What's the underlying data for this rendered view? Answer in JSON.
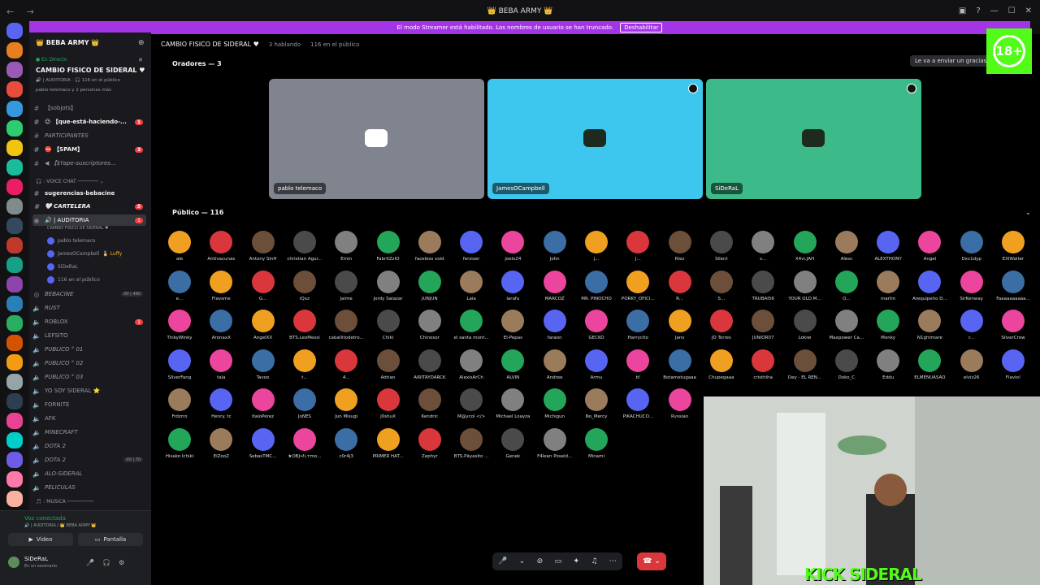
{
  "window": {
    "title": "👑 BEBA ARMY 👑",
    "nav": "← →"
  },
  "banner": {
    "text": "El modo Streamer está habilitado. Los nombres de usuario se han truncado.",
    "button": "Deshabilitar"
  },
  "guild": {
    "name": "👑 BEBA ARMY 👑"
  },
  "event": {
    "live": "● En Directo",
    "title": "CAMBIO FISICO DE SIDERAL ♥",
    "meta": "🔊 | AUDITORIA · 🎧 116 en el público",
    "sub": "pablo telemaco y 2 personas más"
  },
  "channels": [
    {
      "label": "【sobjots】",
      "icon": "#",
      "style": ""
    },
    {
      "label": "😕 【que-está-haciendo-...",
      "icon": "#",
      "style": "bold",
      "badge": "1"
    },
    {
      "label": "PARTICIPANTES",
      "icon": "#",
      "style": "italic"
    },
    {
      "label": "⛔ 【SPAM】",
      "icon": "#",
      "style": "bold",
      "badge": "3"
    },
    {
      "label": "◀ 【$Yape-suscriptores...",
      "icon": "#",
      "style": "italic"
    },
    {
      "label": "🎧 : VOICE CHAT ─────── ⌄",
      "icon": "",
      "style": "cat"
    },
    {
      "label": "sugerencias-bebacine",
      "icon": "#",
      "style": "bold"
    },
    {
      "label": "🤍 CARTELERA",
      "icon": "#",
      "style": "bold italic",
      "badge": "5"
    },
    {
      "label": "🔊 | AUDITORIA",
      "icon": "◉",
      "style": "active",
      "badge": "1"
    }
  ],
  "subheading": "CAMBIO FISICO DE SIDERAL ♥",
  "voice_users": [
    {
      "name": "pablo telemaco",
      "tag": ""
    },
    {
      "name": "JamesOCampbell",
      "tag": "🏅 Luffy"
    },
    {
      "name": "SiDeRaL",
      "tag": ""
    },
    {
      "name": "116 en el público",
      "tag": ""
    }
  ],
  "channels2": [
    {
      "label": "BEBACINE",
      "icon": "◎",
      "style": "italic",
      "cnt": "00 | 490"
    },
    {
      "label": "RUST",
      "icon": "🔈",
      "style": "italic"
    },
    {
      "label": "ROBLOX",
      "icon": "🔈",
      "style": "",
      "badge": "1"
    },
    {
      "label": "LEFSITO",
      "icon": "🔈",
      "style": ""
    },
    {
      "label": "PUBLICO ° 01",
      "icon": "🔈",
      "style": "italic"
    },
    {
      "label": "PUBLICO ° 02",
      "icon": "🔈",
      "style": "italic"
    },
    {
      "label": "PUBLICO ° 03",
      "icon": "🔈",
      "style": "italic"
    },
    {
      "label": "YO SOY SIDERAL ⭐",
      "icon": "🔈",
      "style": ""
    },
    {
      "label": "FORNITE",
      "icon": "🔈",
      "style": ""
    },
    {
      "label": "AFK",
      "icon": "🔈",
      "style": ""
    },
    {
      "label": "MINECRAFT",
      "icon": "🔈",
      "style": "italic"
    },
    {
      "label": "DOTA 2",
      "icon": "🔈",
      "style": "italic"
    },
    {
      "label": "DOTA 2",
      "icon": "🔈",
      "style": "italic",
      "cnt": "00 | 70"
    },
    {
      "label": "ALO-SIDERAL",
      "icon": "🔈",
      "style": "italic"
    },
    {
      "label": "PELICULAS",
      "icon": "🔈",
      "style": "italic"
    },
    {
      "label": "🎵 : MUSICA ─────────",
      "icon": "",
      "style": "cat"
    }
  ],
  "voice_panel": {
    "status": "Voz conectada",
    "sub": "🔊 | AUDITORIA / 👑 BEBA ARMY 👑",
    "video": "Video",
    "screen": "Pantalla"
  },
  "user": {
    "name": "SiDeRaL",
    "status": "En un escenario"
  },
  "stage": {
    "title": "CAMBIO FISICO DE SIDERAL ♥",
    "speaking": "3 hablando",
    "audience": "116 en el público"
  },
  "speakers_heading": "Oradores — 3",
  "speakers": [
    {
      "name": "pablo telemaco",
      "color": "#80848e"
    },
    {
      "name": "JamesOCampbell",
      "color": "#3ec7ee"
    },
    {
      "name": "SiDeRaL",
      "color": "#3dba8a"
    }
  ],
  "public_heading": "Público — 116",
  "toast": "Le va a enviar un gracias p",
  "age_badge": "18+",
  "audience": [
    [
      "ale",
      "Antivacunas",
      "Antony SinH",
      "christian Agui...",
      "Emin",
      "FabritZzIO",
      "faceless void",
      "ferzizer",
      "joelx24",
      "John",
      "j...",
      "J...",
      "Riez",
      "Silent",
      "s...",
      "X4vi.JAH",
      "Aless",
      "ALEXTHONY",
      "Angel",
      "Dxv1dyp",
      "EXIWalter"
    ],
    [
      "e...",
      "Flavsme",
      "G...",
      "iQxz",
      "Jaime",
      "Jordy Salazar",
      "JUNJUN",
      "Laia",
      "larafu",
      "MARCOZ",
      "MR. PINOCHO",
      "PORKY_OFICI...",
      "R...",
      "S...",
      "TRUBAI56",
      "YOUR OLD M...",
      "O...",
      "martin",
      "Arequipeño D...",
      "SirKenway",
      "Faaaaaaaaaa..."
    ],
    [
      "TinkyWinky",
      "AronaxX",
      "AngelXX",
      "BTS.LeoMessi",
      "caballitodetro...",
      "Chiki",
      "Chinosor",
      "el santa mont...",
      "El-Pepas",
      "faraon",
      "GECKO",
      "Harrycito",
      "Jans",
      "JD Torres",
      "JUNIOR07",
      "Lokiw",
      "Maxpower Ca...",
      "Monky",
      "N1ghtmare",
      "r...",
      "SilverCrow"
    ],
    [
      "SilverFang",
      "tala",
      "Tavoo",
      "t...",
      "4...",
      "Adrian",
      "AIRITAYDARCK",
      "AlexisArCh",
      "ALVIN",
      "Andree",
      "Armu",
      "b!",
      "Botametugaaa",
      "Chupegaaa",
      "cristhiha",
      "Dey - EL REN...",
      "Doko_C",
      "Eddu",
      "ELMENUASAO",
      "elviz26",
      "Flavio!"
    ],
    [
      "Frdzrro",
      "Henry. tc",
      "ItaloPérez",
      "JoNES",
      "Jun Misugi",
      "J0shuX",
      "Kendric",
      "M@ycol </>",
      "Michael Loayza",
      "Michigun",
      "No_Mercy",
      "PIKACHUCO...",
      "Rvssian"
    ],
    [
      "Hisako Ichiki",
      "ElZooZ",
      "SebasTMC...",
      "★OBJ•ℓι.τmo...",
      "c0r4j3",
      "PRIMER HAT...",
      "Zephyr",
      "BTS.Pāyasito ...",
      "Genek",
      "F4leen Poseid...",
      "Minami"
    ]
  ],
  "overlay": {
    "brand": "KICK SIDERAL"
  },
  "colors": {
    "discord_blurple": "#5865f2",
    "banner": "#a335e6",
    "kick_green": "#53fc18",
    "hangup": "#da373c"
  }
}
